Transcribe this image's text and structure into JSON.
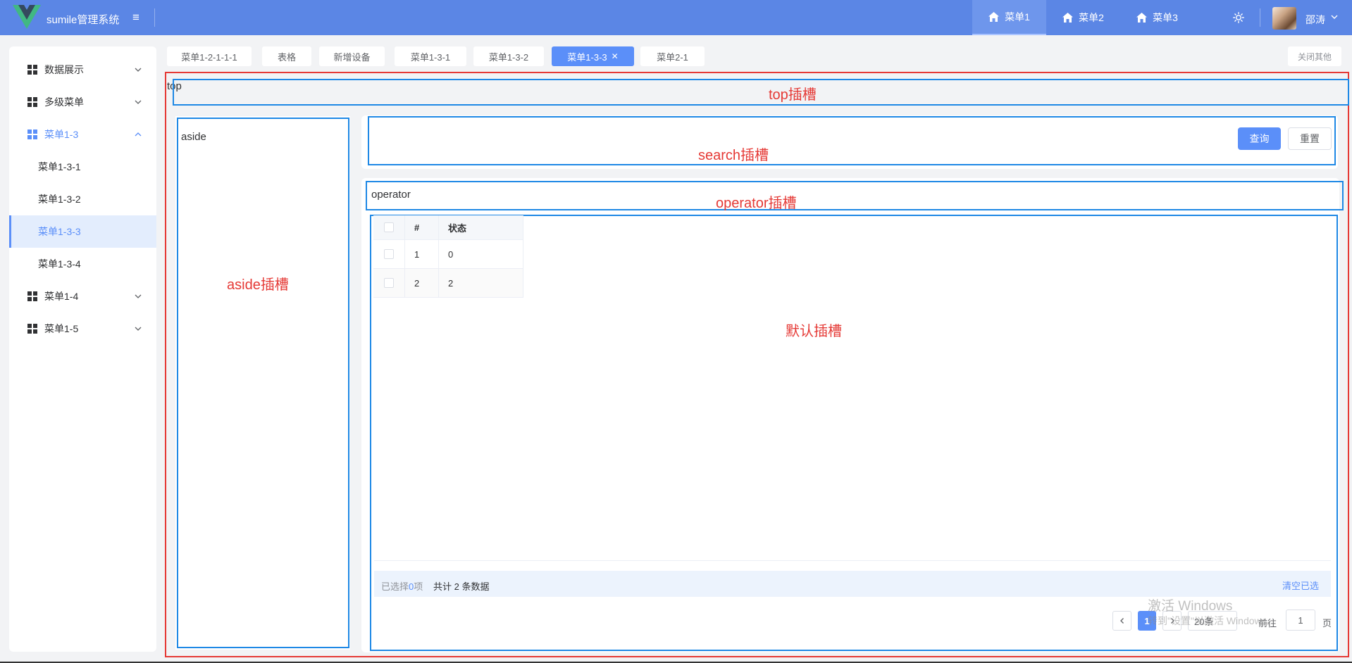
{
  "header": {
    "app_title": "sumile管理系统",
    "nav": [
      {
        "label": "菜单1",
        "active": true
      },
      {
        "label": "菜单2",
        "active": false
      },
      {
        "label": "菜单3",
        "active": false
      }
    ],
    "username": "邵涛",
    "icons": {
      "logo": "vue-logo-icon",
      "menu": "hamburger-icon",
      "theme": "sun-icon",
      "home": "home-icon"
    },
    "colors": {
      "bar": "#5b86e5",
      "accent": "#5b8ff9"
    }
  },
  "sidebar": {
    "items": [
      {
        "label": "数据展示",
        "icon": "grid-icon",
        "state": "collapsed"
      },
      {
        "label": "多级菜单",
        "icon": "grid-icon",
        "state": "collapsed"
      },
      {
        "label": "菜单1-3",
        "icon": "grid-icon",
        "state": "expanded"
      },
      {
        "label": "菜单1-4",
        "icon": "grid-icon",
        "state": "collapsed"
      },
      {
        "label": "菜单1-5",
        "icon": "grid-icon",
        "state": "collapsed"
      }
    ],
    "subitems": [
      {
        "label": "菜单1-3-1",
        "active": false
      },
      {
        "label": "菜单1-3-2",
        "active": false
      },
      {
        "label": "菜单1-3-3",
        "active": true
      },
      {
        "label": "菜单1-3-4",
        "active": false
      }
    ]
  },
  "tabs": [
    {
      "label": "菜单1-2-1-1-1",
      "active": false
    },
    {
      "label": "表格",
      "active": false
    },
    {
      "label": "新增设备",
      "active": false
    },
    {
      "label": "菜单1-3-1",
      "active": false
    },
    {
      "label": "菜单1-3-2",
      "active": false
    },
    {
      "label": "菜单1-3-3",
      "active": true
    },
    {
      "label": "菜单2-1",
      "active": false
    }
  ],
  "close_others": "关闭其他",
  "slots": {
    "top_text": "top",
    "top_label": "top插槽",
    "aside_text": "aside",
    "aside_label": "aside插槽",
    "search_label": "search插槽",
    "operator_text": "operator",
    "operator_label": "operator插槽",
    "default_label": "默认插槽"
  },
  "search": {
    "query_button": "查询",
    "reset_button": "重置"
  },
  "table": {
    "columns": [
      "#",
      "状态"
    ],
    "rows": [
      {
        "index": "1",
        "status": "0"
      },
      {
        "index": "2",
        "status": "2"
      }
    ]
  },
  "selection": {
    "prefix": "已选择",
    "count": "0",
    "suffix": "项",
    "total": "共计 2 条数据",
    "clear": "清空已选"
  },
  "pagination": {
    "current_page": "1",
    "page_size": "20条",
    "goto_label": "前往",
    "goto_value": "1",
    "page_suffix": "页"
  },
  "watermark": {
    "line1": "激活 Windows",
    "line2": "转到\"设置\"以激活 Windows。"
  }
}
